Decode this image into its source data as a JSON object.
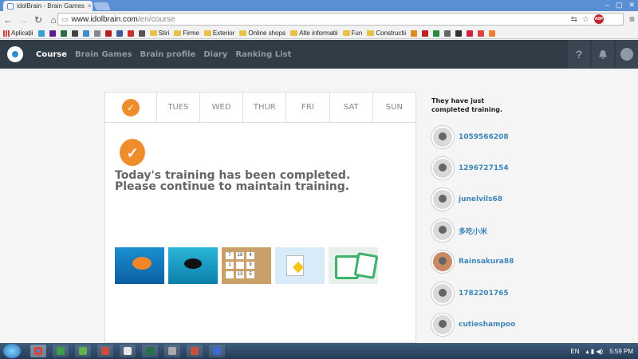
{
  "browser": {
    "tab_title": "idolBrain - Brain Games &",
    "url_host": "www.idolbrain.com",
    "url_path": "/en/course",
    "bookmarks": [
      {
        "label": "Aplicații",
        "icon": "apps-grid-icon"
      },
      {
        "label": "",
        "icon": "bookmark-b-icon",
        "color": "#3aa0d0"
      },
      {
        "label": "",
        "icon": "yahoo-icon",
        "color": "#5b1e8c"
      },
      {
        "label": "",
        "icon": "bookmark-icon",
        "color": "#2c6a3f"
      },
      {
        "label": "",
        "icon": "bookmark-icon",
        "color": "#444444"
      },
      {
        "label": "",
        "icon": "bookmark-t-icon",
        "color": "#3a8fc8"
      },
      {
        "label": "",
        "icon": "bookmark-rl-icon",
        "color": "#888888"
      },
      {
        "label": "",
        "icon": "bookmark-icon",
        "color": "#b02020"
      },
      {
        "label": "",
        "icon": "facebook-icon",
        "color": "#3b5998"
      },
      {
        "label": "",
        "icon": "bookmark-icon",
        "color": "#c83030"
      },
      {
        "label": "",
        "icon": "bookmark-icon",
        "color": "#555555"
      },
      {
        "label": "Stiri",
        "icon": "folder-icon"
      },
      {
        "label": "Firme",
        "icon": "folder-icon"
      },
      {
        "label": "Exterior",
        "icon": "folder-icon"
      },
      {
        "label": "Online shops",
        "icon": "folder-icon"
      },
      {
        "label": "Alte informatii",
        "icon": "folder-icon"
      },
      {
        "label": "Fun",
        "icon": "folder-icon"
      },
      {
        "label": "Constructii",
        "icon": "folder-icon"
      }
    ]
  },
  "site": {
    "nav": [
      "Course",
      "Brain Games",
      "Brain profile",
      "Diary",
      "Ranking List"
    ],
    "help_icon": "?",
    "days": [
      "TUES",
      "WED",
      "THUR",
      "FRI",
      "SAT",
      "SUN"
    ],
    "completed_message": "Today's training has been completed. Please continue to maintain training.",
    "games": [
      "game-fish",
      "game-silhouette",
      "game-number-tiles",
      "game-cards",
      "game-dice"
    ],
    "tile_numbers": [
      "7",
      "18",
      "4",
      "1",
      "",
      "9",
      "",
      "13",
      "5"
    ],
    "sidebar_title": "They have just completed training.",
    "users": [
      "1059566208",
      "1296727154",
      "junelvils68",
      "多吃小米",
      "Rainsakura88",
      "1782201765",
      "cutieshampoo"
    ]
  },
  "taskbar": {
    "language": "EN",
    "time": "5:59 PM"
  },
  "colors": {
    "nav_bg": "#303c46",
    "accent_orange": "#ef8d2c",
    "link_blue": "#3d86b8"
  }
}
